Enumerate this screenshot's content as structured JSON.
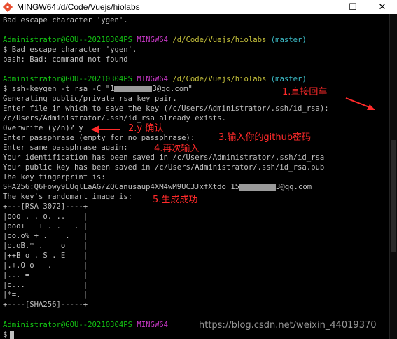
{
  "window": {
    "title": "MINGW64:/d/Code/Vuejs/hiolabs",
    "minimize_label": "—",
    "maximize_label": "☐",
    "close_label": "✕"
  },
  "prompt": {
    "user": "Administrator@GOU--20210304PS",
    "shell": "MINGW64",
    "path": "/d/Code/Vuejs/hiolabs",
    "branch": "(master)"
  },
  "terminal": {
    "line_bad_escape_1": "Bad escape character 'ygen'.",
    "cmd_1": "$ Bad escape character 'ygen'.",
    "out_bash": "bash: Bad: command not found",
    "cmd_2_a": "$ ssh-keygen -t rsa -C \"1",
    "cmd_2_b": "3@qq.com\"",
    "out_generating": "Generating public/private rsa key pair.",
    "out_enter_file": "Enter file in which to save the key (/c/Users/Administrator/.ssh/id_rsa):",
    "out_already": "/c/Users/Administrator/.ssh/id_rsa already exists.",
    "out_overwrite": "Overwrite (y/n)? y",
    "out_passphrase": "Enter passphrase (empty for no passphrase):",
    "out_same": "Enter same passphrase again:",
    "out_ident": "Your identification has been saved in /c/Users/Administrator/.ssh/id_rsa",
    "out_pub": "Your public key has been saved in /c/Users/Administrator/.ssh/id_rsa.pub",
    "out_fp_label": "The key fingerprint is:",
    "out_fp_a": "SHA256:Q6Fowy9LUqlLaAG/ZQCanusaup4XM4wM9UC3JxfXtdo 15",
    "out_fp_b": "3@qq.com",
    "out_randomart": "The key's randomart image is:",
    "art": [
      "+---[RSA 3072]----+",
      "|ooo . . o. ..    |",
      "|ooo+ + + . .   . |",
      "|oo.o% + .    .   |",
      "|o.oB.* .    o    |",
      "|++B o . S . E    |",
      "|.+.O o   .       |",
      "|... =            |",
      "|o...             |",
      "|*=.              |",
      "+----[SHA256]-----+"
    ],
    "final_prompt": "$"
  },
  "annotations": {
    "step1": "1.直接回车",
    "step2": "2.y 确认",
    "step3": "3.输入你的github密码",
    "step4": "4.再次输入",
    "step5": "5.生成成功"
  },
  "watermark": "https://blog.csdn.net/weixin_44019370",
  "colors": {
    "prompt_user": "#13c313",
    "prompt_shell": "#c838c6",
    "prompt_path": "#c6c23b",
    "prompt_branch": "#3ab7c2",
    "annotation": "#ff2a2a"
  }
}
